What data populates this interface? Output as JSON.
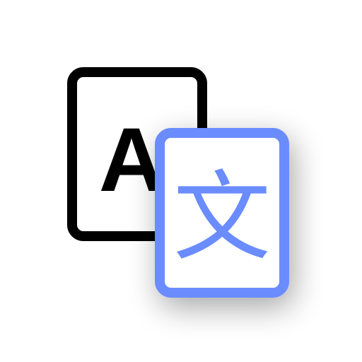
{
  "icon": {
    "name": "translate-icon",
    "source_card": {
      "glyph": "A",
      "icon_name": "latin-letter-card-icon",
      "stroke_color": "#000000",
      "fill_color": "#ffffff"
    },
    "target_card": {
      "glyph": "文",
      "icon_name": "chinese-character-card-icon",
      "stroke_color": "#6b8cff",
      "glyph_color": "#6b8cff",
      "fill_color": "#ffffff"
    },
    "shadow_color": "#000000"
  }
}
